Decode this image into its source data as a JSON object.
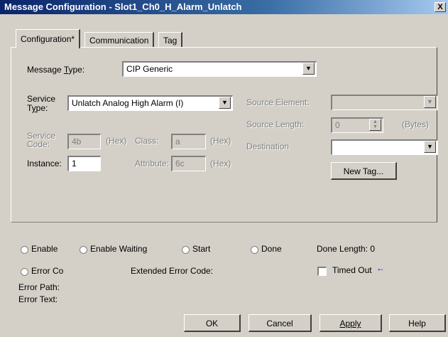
{
  "window": {
    "title": "Message Configuration - Slot1_Ch0_H_Alarm_Unlatch",
    "close_glyph": "X"
  },
  "tabs": [
    {
      "label": "Configuration*",
      "active": true
    },
    {
      "label": "Communication",
      "active": false
    },
    {
      "label": "Tag",
      "active": false
    }
  ],
  "config": {
    "message_type_label_pre": "Message ",
    "message_type_label_ul": "T",
    "message_type_label_post": "ype:",
    "message_type_value": "CIP Generic",
    "service_type_label_line1": "Service",
    "service_type_label_line2_ul": "y",
    "service_type_label_line2_pre": "T",
    "service_type_label_line2_post": "pe:",
    "service_type_value": "Unlatch Analog High Alarm (I)",
    "service_code_label_line1": "Service",
    "service_code_label_line2": "Code:",
    "service_code_value": "4b",
    "hex1": "(Hex)",
    "class_label": "Class:",
    "class_value": "a",
    "hex2": "(Hex)",
    "instance_label": "Instance:",
    "instance_value": "1",
    "attribute_label": "Attribute:",
    "attribute_value": "6c",
    "hex3": "(Hex)",
    "source_element_label": "Source Element:",
    "source_length_label": "Source Length:",
    "source_length_value": "0",
    "bytes_label": "(Bytes)",
    "destination_label": "Destination",
    "new_tag_label": "New Tag..."
  },
  "status": {
    "enable": "Enable",
    "enable_waiting": "Enable Waiting",
    "start": "Start",
    "done": "Done",
    "done_length": "Done Length: 0",
    "error_code": "Error Co",
    "extended_error_code": "Extended Error Code:",
    "timed_out": "Timed Out",
    "timed_out_arrow": "←",
    "error_path": "Error Path:",
    "error_text": "Error Text:"
  },
  "buttons": {
    "ok": "OK",
    "cancel": "Cancel",
    "apply": "Apply",
    "help": "Help"
  },
  "colors": {
    "title_bar": "#0a246a",
    "face": "#d4d0c8",
    "arrow": "#0000ff"
  }
}
